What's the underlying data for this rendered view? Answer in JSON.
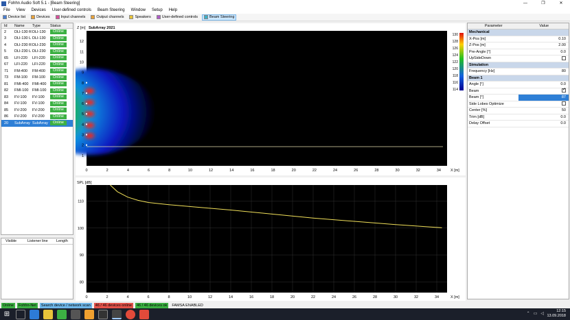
{
  "window": {
    "title": "Fohhn Audio Soft 5.1 - [Beam Steering]",
    "controls": [
      "—",
      "❐",
      "✕"
    ]
  },
  "menu": [
    "File",
    "View",
    "Devices",
    "User-defined controls",
    "Beam Steering",
    "Window",
    "Setup",
    "Help"
  ],
  "toolbar": [
    {
      "label": "Device list",
      "color": "#4a7fd1"
    },
    {
      "label": "Devices",
      "color": "#e8a23a"
    },
    {
      "label": "Input channels",
      "color": "#d94f9b"
    },
    {
      "label": "Output channels",
      "color": "#e8a23a"
    },
    {
      "label": "Speakers",
      "color": "#e8c43a"
    },
    {
      "label": "User-defined controls",
      "color": "#b05cc9"
    },
    {
      "label": "Beam Steering",
      "color": "#3ab0c9",
      "active": true
    }
  ],
  "device_table": {
    "headers": [
      "Id",
      "Name",
      "Type",
      "Status"
    ],
    "rows": [
      {
        "id": "2",
        "name": "DLI-130 R",
        "type": "DLI-130",
        "status": "Online"
      },
      {
        "id": "3",
        "name": "DLI-130 L",
        "type": "DLI-130",
        "status": "Online"
      },
      {
        "id": "4",
        "name": "DLI-230 R",
        "type": "DLI-230",
        "status": "Online"
      },
      {
        "id": "5",
        "name": "DLI-230 L",
        "type": "DLI-230",
        "status": "Online"
      },
      {
        "id": "65",
        "name": "LFI-220",
        "type": "LFI-220",
        "status": "Online"
      },
      {
        "id": "67",
        "name": "LFI-220",
        "type": "LFI-220",
        "status": "Online"
      },
      {
        "id": "71",
        "name": "FM-400",
        "type": "FM-400",
        "status": "Online"
      },
      {
        "id": "73",
        "name": "FM-100",
        "type": "FM-100",
        "status": "Online"
      },
      {
        "id": "81",
        "name": "FMI-400",
        "type": "FMI-400",
        "status": "Online"
      },
      {
        "id": "82",
        "name": "FMI-100",
        "type": "FMI-100",
        "status": "Online"
      },
      {
        "id": "83",
        "name": "FV-100",
        "type": "FV-100",
        "status": "Online"
      },
      {
        "id": "84",
        "name": "FV-100",
        "type": "FV-100",
        "status": "Online"
      },
      {
        "id": "85",
        "name": "FV-200",
        "type": "FV-200",
        "status": "Online"
      },
      {
        "id": "86",
        "name": "FV-200",
        "type": "FV-200",
        "status": "Online"
      },
      {
        "id": "20",
        "name": "SubArray",
        "type": "SubArray",
        "status": "Online",
        "selected": true
      }
    ]
  },
  "listener_table": {
    "headers": [
      "Visible",
      "Listener line",
      "Length"
    ]
  },
  "plot_top": {
    "title": "SubArray 2021",
    "y_label": "Z [m]",
    "x_label": "X [m]",
    "y_ticks": [
      "12",
      "11",
      "10",
      "9",
      "8",
      "7",
      "6",
      "5",
      "4",
      "3",
      "2",
      "1"
    ],
    "x_ticks": [
      "0",
      "2",
      "4",
      "6",
      "8",
      "10",
      "12",
      "14",
      "16",
      "18",
      "20",
      "22",
      "24",
      "26",
      "28",
      "30",
      "32",
      "34"
    ],
    "colorbar_ticks": [
      "130",
      "128",
      "126",
      "124",
      "122",
      "120",
      "118",
      "116",
      "114"
    ]
  },
  "plot_bottom": {
    "y_label": "SPL [dB]",
    "x_label": "X [m]",
    "y_ticks": [
      "110",
      "100",
      "90",
      "80"
    ],
    "x_ticks": [
      "0",
      "2",
      "4",
      "6",
      "8",
      "10",
      "12",
      "14",
      "16",
      "18",
      "20",
      "22",
      "24",
      "26",
      "28",
      "30",
      "32",
      "34"
    ]
  },
  "chart_data": {
    "type": "line",
    "xlabel": "X [m]",
    "ylabel": "SPL [dB]",
    "xlim": [
      0,
      35
    ],
    "ylim": [
      76,
      116
    ],
    "series": [
      {
        "x": [
          2.3,
          3,
          4,
          5,
          6,
          8,
          10,
          14,
          18,
          22,
          26,
          30,
          34.5
        ],
        "values": [
          116,
          113.5,
          111.5,
          110.3,
          109.5,
          108.7,
          108,
          106.7,
          105.2,
          103.7,
          102.5,
          101.3,
          100.1
        ]
      }
    ]
  },
  "properties": {
    "headers": [
      "Parameter",
      "Value"
    ],
    "rows": [
      {
        "section": "Mechanical"
      },
      {
        "param": "X-Pos [m]",
        "value": "0.10"
      },
      {
        "param": "Z-Pos [m]",
        "value": "2.00"
      },
      {
        "param": "Pre-Angle [°]",
        "value": "0.0"
      },
      {
        "param": "UpSideDown",
        "check": false
      },
      {
        "section": "Simulation"
      },
      {
        "param": "Frequency [Hz]",
        "value": "80"
      },
      {
        "section": "Beam 1"
      },
      {
        "param": "Angle [°]",
        "value": "0.0"
      },
      {
        "param": "Beam",
        "check": true
      },
      {
        "param": "Beam [°]",
        "value": "87",
        "highlight": true
      },
      {
        "param": "Side Lobes Optimize",
        "check": false
      },
      {
        "param": "Center [%]",
        "value": "50"
      },
      {
        "param": "Trim [dB]",
        "value": "0.0"
      },
      {
        "param": "Delay Offset",
        "value": "0.0"
      }
    ]
  },
  "statusbar": [
    {
      "label": "Online",
      "color": "#3cb043"
    },
    {
      "label": "Fohhn-Net",
      "color": "#3cb043"
    },
    {
      "label": "Search device / network scan",
      "color": "#6fb6e8"
    },
    {
      "label": "46 / 46 devices online",
      "color": "#e2524a"
    },
    {
      "label": "46 / 46 devices ok",
      "color": "#3cb043"
    },
    {
      "label": "FAMSA ENABLED",
      "color": "transparent"
    }
  ],
  "tray": {
    "time": "12:15",
    "date": "13.09.2018"
  }
}
